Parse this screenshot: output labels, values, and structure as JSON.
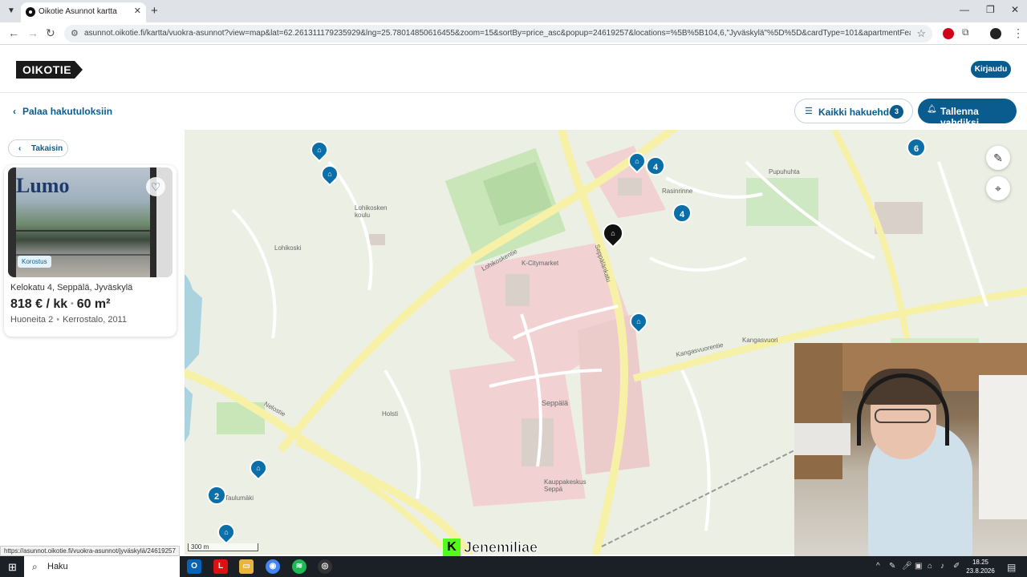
{
  "browser": {
    "tab_title": "Oikotie Asunnot kartta",
    "url": "asunnot.oikotie.fi/kartta/vuokra-asunnot?view=map&lat=62.261311179235929&lng=25.78014850616455&zoom=15&sortBy=price_asc&popup=24619257&locations=%5B%5B104,6,\"Jyväskylä\"%5D%5D&cardType=101&apartmentFeatures%5B%5D..."
  },
  "header": {
    "logo": "OIKOTIE",
    "login": "Kirjaudu"
  },
  "subbar": {
    "back_results": "Palaa hakutuloksiin",
    "all_filters": "Kaikki hakuehdot",
    "filter_count": "3",
    "save_search": "Tallenna vahdiksi"
  },
  "panel": {
    "back": "Takaisin",
    "card": {
      "badge": "Korostus",
      "watermark": "Lumo",
      "address": "Kelokatu 4, Seppälä, Jyväskylä",
      "price": "818 € / kk",
      "size": "60 m²",
      "rooms": "Huoneita 2",
      "building": "Kerrostalo, 2011"
    }
  },
  "map": {
    "labels": [
      {
        "text": "Lohikoski"
      },
      {
        "text": "Lohikosken koulu"
      },
      {
        "text": "K-Citymarket"
      },
      {
        "text": "Rasinrinne"
      },
      {
        "text": "Pupuhuhta"
      },
      {
        "text": "Kangasvuori"
      },
      {
        "text": "Seppälä"
      },
      {
        "text": "Kauppakeskus Seppä"
      },
      {
        "text": "Holsti"
      },
      {
        "text": "Taulumäki"
      },
      {
        "text": "Lohikoskentie"
      },
      {
        "text": "Seppälänkatu"
      },
      {
        "text": "Kangasvuorentie"
      },
      {
        "text": "Nelostie"
      }
    ],
    "clusters": [
      "6",
      "4",
      "4",
      "4",
      "2"
    ],
    "scale": "300 m"
  },
  "overlay": {
    "status_url": "https://asunnot.oikotie.fi/vuokra-asunnot/jyväskylä/24619257",
    "streamer": "Jenemiliae"
  },
  "taskbar": {
    "search": "Haku",
    "time": "18.25",
    "date": "23.8.2026"
  }
}
